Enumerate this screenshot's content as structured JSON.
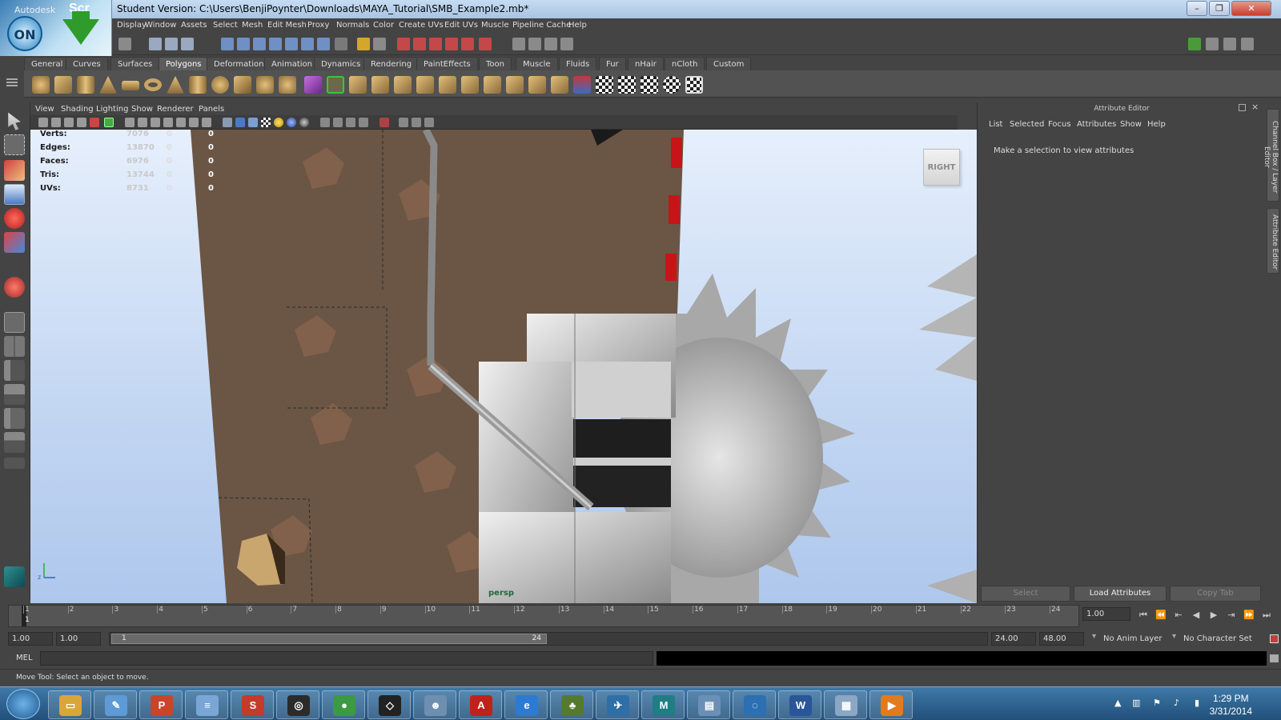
{
  "window": {
    "title": "Student Version: C:\\Users\\BenjiPoynter\\Downloads\\MAYA_Tutorial\\SMB_Example2.mb*",
    "minimize": "–",
    "maximize": "❐",
    "close": "✕"
  },
  "overlay": {
    "brand": "Scr",
    "badge": "ON",
    "label": "Autodesk"
  },
  "menubar": [
    "Display",
    "Window",
    "Assets",
    "Select",
    "Mesh",
    "Edit Mesh",
    "Proxy",
    "Normals",
    "Color",
    "Create UVs",
    "Edit UVs",
    "Muscle",
    "Pipeline Cache",
    "Help"
  ],
  "shelf_tabs": [
    "General",
    "Curves",
    "Surfaces",
    "Polygons",
    "Deformation",
    "Animation",
    "Dynamics",
    "Rendering",
    "PaintEffects",
    "Toon",
    "Muscle",
    "Fluids",
    "Fur",
    "nHair",
    "nCloth",
    "Custom"
  ],
  "active_shelf_tab": "Polygons",
  "panel_menu": [
    "View",
    "Shading",
    "Lighting",
    "Show",
    "Renderer",
    "Panels"
  ],
  "hud": [
    {
      "label": "Verts:",
      "value": "7076",
      "sel": "0",
      "comp": "0"
    },
    {
      "label": "Edges:",
      "value": "13870",
      "sel": "0",
      "comp": "0"
    },
    {
      "label": "Faces:",
      "value": "6976",
      "sel": "0",
      "comp": "0"
    },
    {
      "label": "Tris:",
      "value": "13744",
      "sel": "0",
      "comp": "0"
    },
    {
      "label": "UVs:",
      "value": "8731",
      "sel": "0",
      "comp": "0"
    }
  ],
  "viewcube_label": "RIGHT",
  "camera_label": "persp",
  "attribute_editor": {
    "title": "Attribute Editor",
    "menu": [
      "List",
      "Selected",
      "Focus",
      "Attributes",
      "Show",
      "Help"
    ],
    "message": "Make a selection to view attributes",
    "buttons": [
      "Select",
      "Load Attributes",
      "Copy Tab"
    ]
  },
  "side_tabs": [
    "Channel Box / Layer Editor",
    "Attribute Editor"
  ],
  "timeline": {
    "ticks": [
      "1",
      "2",
      "3",
      "4",
      "5",
      "6",
      "7",
      "8",
      "9",
      "10",
      "11",
      "12",
      "13",
      "14",
      "15",
      "16",
      "17",
      "18",
      "19",
      "20",
      "21",
      "22",
      "23",
      "24"
    ],
    "current_frame": "1",
    "current_time_field": "1.00"
  },
  "range": {
    "start_field": "1.00",
    "playback_start": "1.00",
    "range_start": "1",
    "range_end": "24",
    "playback_end": "24.00",
    "end_field": "48.00",
    "anim_layer": "No Anim Layer",
    "character_set": "No Character Set"
  },
  "command": {
    "label": "MEL",
    "value": ""
  },
  "help_line": "Move Tool: Select an object to move.",
  "taskbar": {
    "time": "1:29 PM",
    "date": "3/31/2014",
    "apps": [
      {
        "name": "file-explorer-icon",
        "glyph": "▭",
        "color": "#d9a63a"
      },
      {
        "name": "paint-icon",
        "glyph": "✎",
        "color": "#5d9ad6"
      },
      {
        "name": "powerpoint-icon",
        "glyph": "P",
        "color": "#c8452b"
      },
      {
        "name": "notepad-icon",
        "glyph": "≡",
        "color": "#7aa6d6"
      },
      {
        "name": "sketchup-icon",
        "glyph": "S",
        "color": "#c23b2c"
      },
      {
        "name": "steam-icon",
        "glyph": "◎",
        "color": "#2b2b2b"
      },
      {
        "name": "chrome-icon",
        "glyph": "●",
        "color": "#3c9a43"
      },
      {
        "name": "unity-icon",
        "glyph": "◇",
        "color": "#222222"
      },
      {
        "name": "character-app-icon",
        "glyph": "☻",
        "color": "#6f8fb0"
      },
      {
        "name": "acrobat-icon",
        "glyph": "A",
        "color": "#c0211d"
      },
      {
        "name": "internet-explorer-icon",
        "glyph": "e",
        "color": "#2a7bd1"
      },
      {
        "name": "game-app-icon",
        "glyph": "♣",
        "color": "#557a2f"
      },
      {
        "name": "wing-app-icon",
        "glyph": "✈",
        "color": "#2f6fa8"
      },
      {
        "name": "maya-icon",
        "glyph": "M",
        "color": "#1e7e84"
      },
      {
        "name": "photo-viewer-icon",
        "glyph": "▤",
        "color": "#6c8fb5"
      },
      {
        "name": "browser-icon",
        "glyph": "◌",
        "color": "#2c6fb2"
      },
      {
        "name": "word-icon",
        "glyph": "W",
        "color": "#2a5599"
      },
      {
        "name": "calculator-icon",
        "glyph": "▦",
        "color": "#8ba7c4"
      },
      {
        "name": "media-player-icon",
        "glyph": "▶",
        "color": "#e07b1f"
      }
    ]
  },
  "colors": {
    "ui_bg": "#444444",
    "sky_top": "#e6effc",
    "wall": "#6b5544",
    "metal": "#b8b8b8",
    "marker_red": "#c81418",
    "taskbar": "#2d6597"
  }
}
